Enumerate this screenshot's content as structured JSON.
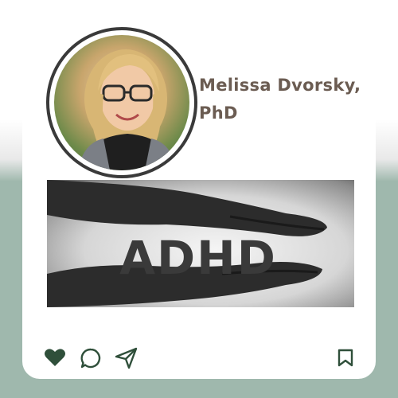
{
  "post": {
    "author_name": "Melissa Dvorsky, PhD",
    "image_text": "ADHD"
  },
  "actions": {
    "like_icon": "heart-icon",
    "comment_icon": "comment-icon",
    "share_icon": "share-icon",
    "save_icon": "bookmark-icon"
  },
  "colors": {
    "accent_green": "#2f4f3a",
    "background_green": "#9fb8ad",
    "name_color": "#6b5c52"
  }
}
